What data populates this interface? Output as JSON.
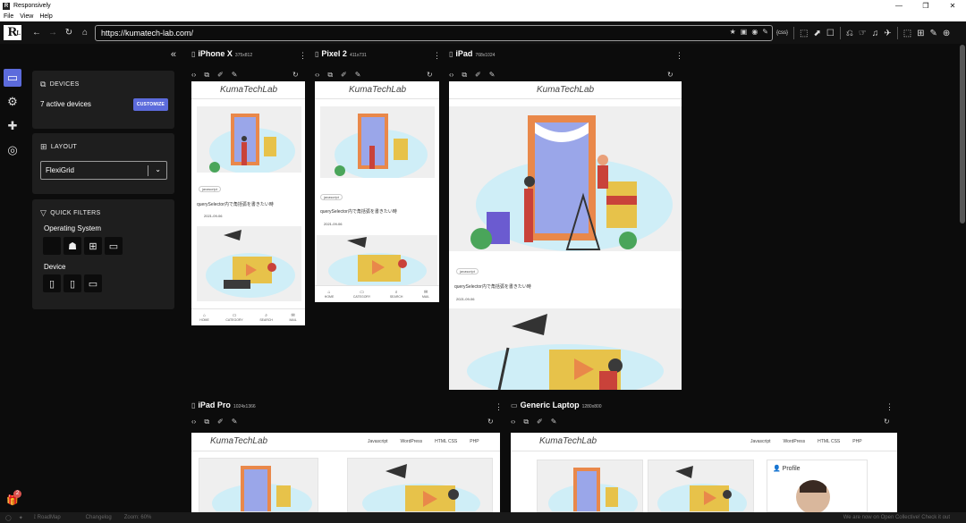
{
  "window": {
    "title": "Responsively",
    "minimize": "—",
    "maximize": "❐",
    "close": "✕"
  },
  "menu": {
    "file": "File",
    "view": "View",
    "help": "Help"
  },
  "toolbar": {
    "logo": "R",
    "logo_sub": "L",
    "back": "←",
    "forward": "→",
    "reload": "↻",
    "home": "⌂",
    "url": "https://kumatech-lab.com/",
    "addr_icons": [
      "★",
      "▣",
      "◉",
      "✎"
    ],
    "css": "{css}",
    "tools": [
      "⬚",
      "⬈",
      "☐",
      "⎌",
      "☞",
      "♫",
      "✈",
      "⬚",
      "⊞",
      "✎",
      "⊕"
    ]
  },
  "rail": {
    "devices_icon": "▭",
    "settings_icon": "⚙",
    "extensions_icon": "✚",
    "network_icon": "◎",
    "gift_icon": "🎁",
    "gift_badge": "2"
  },
  "sidebar": {
    "collapse": "«",
    "devices": {
      "title": "DEVICES",
      "count_text": "7 active devices",
      "customize": "CUSTOMIZE"
    },
    "layout": {
      "title": "LAYOUT",
      "selected": "FlexiGrid"
    },
    "filters": {
      "title": "QUICK FILTERS",
      "os_label": "Operating System",
      "device_label": "Device"
    }
  },
  "site": {
    "title": "KumaTechLab",
    "tag": "javascript",
    "post_title": "querySelector内で角括弧を書きたい時",
    "post_date": "2021-09-06",
    "bottom_nav": {
      "home": "HOME",
      "category": "CATEGORY",
      "search": "SEARCH",
      "mail": "MAIL"
    },
    "desktop_nav": [
      "Javascript",
      "WordPress",
      "HTML CSS",
      "PHP"
    ],
    "profile": "Profile"
  },
  "devices": [
    {
      "name": "iPhone X",
      "size": "375x812"
    },
    {
      "name": "Pixel 2",
      "size": "411x731"
    },
    {
      "name": "iPad",
      "size": "768x1024"
    },
    {
      "name": "iPad Pro",
      "size": "1024x1366"
    },
    {
      "name": "Generic Laptop",
      "size": "1280x800"
    }
  ],
  "statusbar": {
    "roadmap": "RoadMap",
    "changelog": "Changelog",
    "zoom": "Zoom: 60%",
    "announcement": "We are now on Open Collective! Check it out"
  }
}
